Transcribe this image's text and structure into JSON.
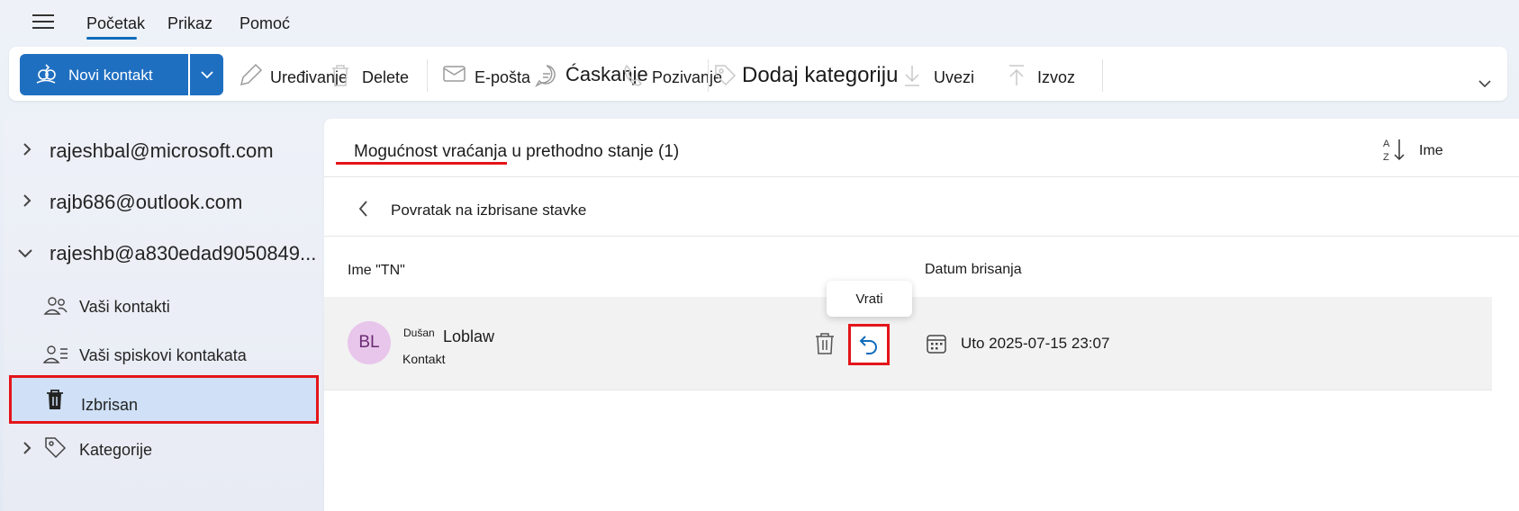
{
  "tabs": [
    {
      "label": "Početak",
      "active": true
    },
    {
      "label": "Prikaz",
      "active": false
    },
    {
      "label": "Pomoć",
      "active": false
    }
  ],
  "ribbon": {
    "new_contact": "Novi kontakt",
    "edit": "Uređivanje",
    "delete": "Delete",
    "email": "E-pošta",
    "chat": "Ćaskanje",
    "call": "Pozivanje",
    "add_category": "Dodaj kategoriju",
    "import": "Uvezi",
    "export": "Izvoz"
  },
  "sidebar": {
    "accounts": [
      {
        "label": "rajeshbal@microsoft.com",
        "expanded": false
      },
      {
        "label": "rajb686@outlook.com",
        "expanded": false
      },
      {
        "label": "rajeshb@a830edad9050849...",
        "expanded": true
      }
    ],
    "items": [
      {
        "label": "Vaši kontakti",
        "icon": "people-icon"
      },
      {
        "label": "Vaši spiskovi kontakata",
        "icon": "contact-list-icon"
      },
      {
        "label": "Izbrisan",
        "icon": "trash-icon",
        "selected": true
      },
      {
        "label": "Kategorije",
        "icon": "tag-icon"
      }
    ]
  },
  "main": {
    "title": "Mogućnost vraćanja u prethodno stanje (1)",
    "sort_label": "Ime",
    "back_label": "Povratak na izbrisane stavke",
    "columns": [
      "Ime \"TN\"",
      "Datum brisanja"
    ],
    "tooltip": "Vrati",
    "rows": [
      {
        "initials": "BL",
        "first_name": "Dušan",
        "last_name": "Loblaw",
        "type": "Kontakt",
        "deleted_date": "Uto 2025-07-15 23:07"
      }
    ]
  },
  "colors": {
    "accent": "#1f6fc1",
    "highlight": "#e3151a",
    "avatar_bg": "#e8c5ea"
  }
}
